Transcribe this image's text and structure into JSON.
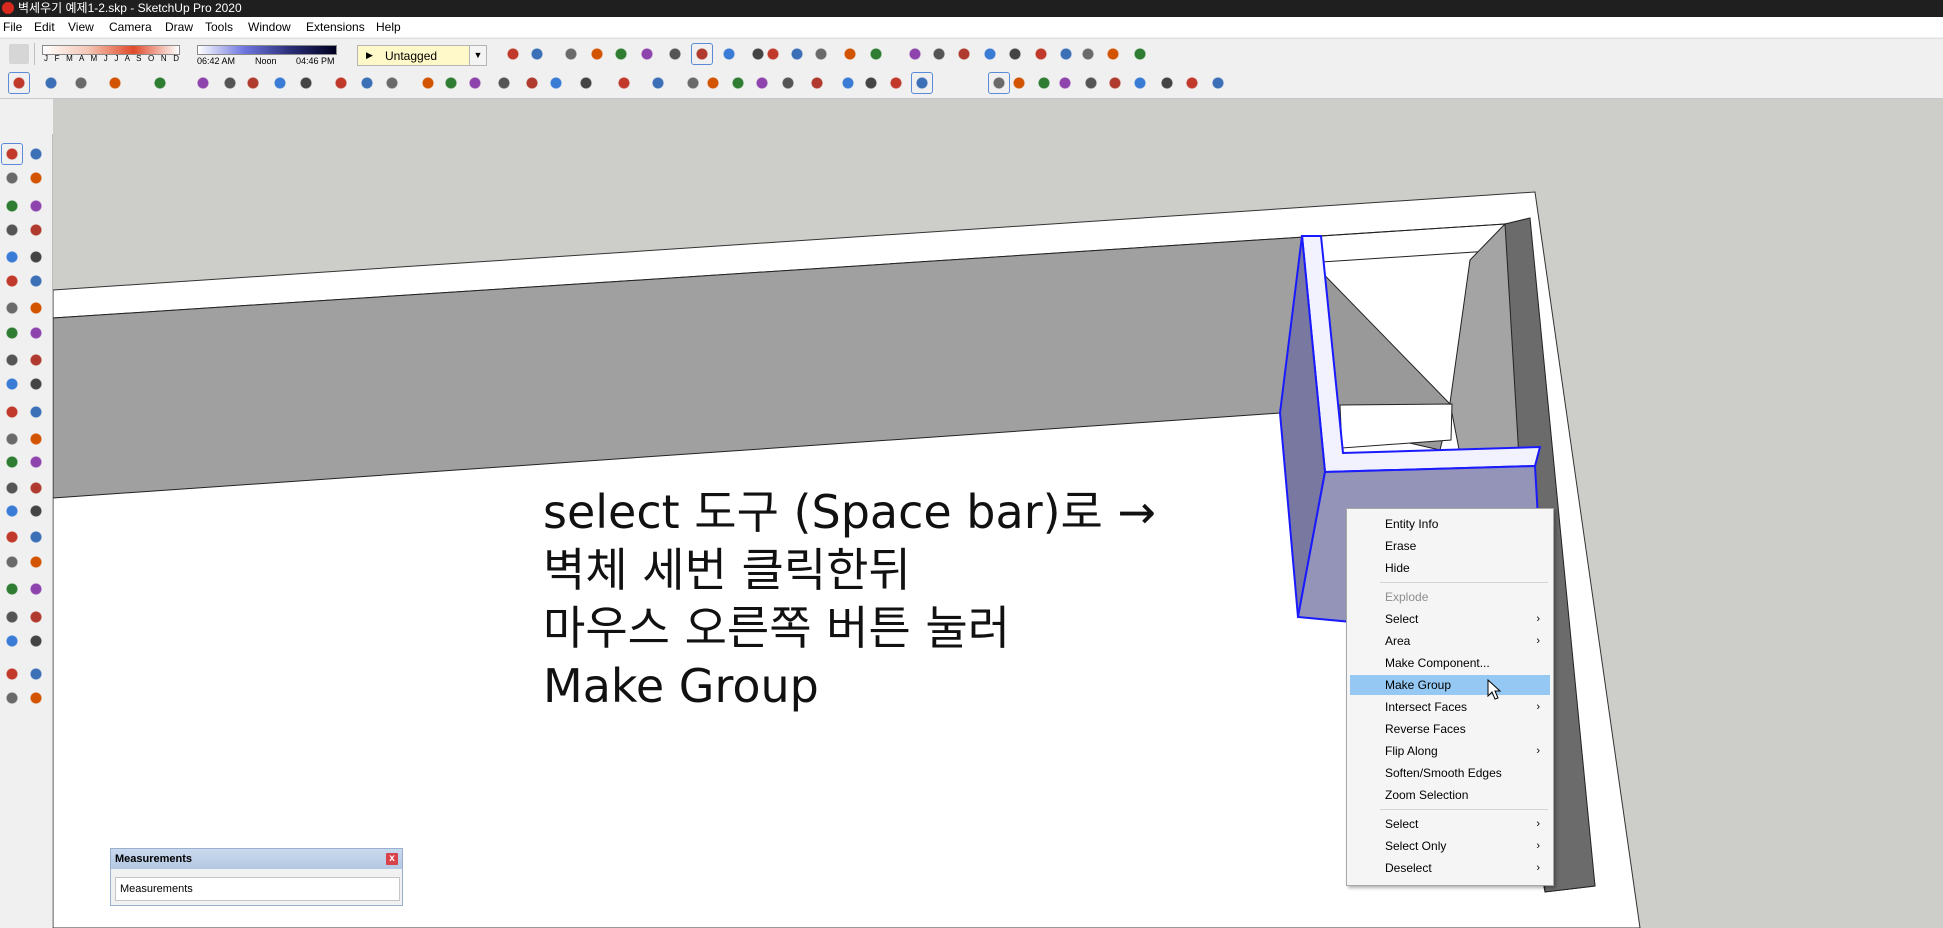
{
  "window": {
    "title": "벽세우기 예제1-2.skp - SketchUp Pro 2020"
  },
  "menu": [
    "File",
    "Edit",
    "View",
    "Camera",
    "Draw",
    "Tools",
    "Window",
    "Extensions",
    "Help"
  ],
  "shadow_settings": {
    "months": "J F M A M J J A S O N D",
    "time_start": "06:42 AM",
    "time_mid": "Noon",
    "time_end": "04:46 PM"
  },
  "tag_dropdown": {
    "value": "Untagged"
  },
  "annotation": {
    "line1": "select 도구 (Space bar)로 →",
    "line2": "벽체 세번 클릭한뒤",
    "line3": "마우스 오른쪽 버튼 눌러",
    "line4": "Make Group"
  },
  "context_menu": {
    "items": [
      {
        "label": "Entity Info"
      },
      {
        "label": "Erase"
      },
      {
        "label": "Hide"
      },
      {
        "label": "Explode",
        "disabled": true
      },
      {
        "label": "Select",
        "submenu": true
      },
      {
        "label": "Area",
        "submenu": true
      },
      {
        "label": "Make Component..."
      },
      {
        "label": "Make Group",
        "highlighted": true
      },
      {
        "label": "Intersect Faces",
        "submenu": true
      },
      {
        "label": "Reverse Faces"
      },
      {
        "label": "Flip Along",
        "submenu": true
      },
      {
        "label": "Soften/Smooth Edges"
      },
      {
        "label": "Zoom Selection"
      },
      {
        "label": "Select",
        "submenu": true
      },
      {
        "label": "Select Only",
        "submenu": true
      },
      {
        "label": "Deselect",
        "submenu": true
      }
    ],
    "submenu_glyph": "›"
  },
  "measurements": {
    "title": "Measurements",
    "field_label": "Measurements",
    "close_glyph": "x"
  },
  "colors": {
    "sky": "#cdcdc9",
    "ground": "#ffffff",
    "wall_top": "#a0a0a0",
    "wall_side": "#6b6b6b",
    "selection": "#1a1aff",
    "menu_highlight": "#95c8f2"
  },
  "icons": {
    "top_toolbar_1": [
      "eraser-icon",
      "box-front-icon",
      "box-top-icon",
      "iso-icon",
      "top-view-icon",
      "front-view-icon",
      "right-view-icon",
      "back-view-icon",
      "left-view-icon",
      "xray-icon",
      "back-edges-icon",
      "wireframe-icon",
      "hidden-line-icon",
      "shaded-icon",
      "shaded-texture-icon",
      "monochrome-icon",
      "section-plane-icon",
      "section-display-icon",
      "walk-icon",
      "look-around-icon",
      "position-camera-icon",
      "zoom-icon",
      "zoom-window-icon",
      "zoom-extents-icon",
      "previous-view-icon",
      "orbit-icon",
      "pan-icon",
      "footprints-icon"
    ],
    "top_toolbar_2": [
      "select-icon",
      "eraser-icon",
      "pencil-icon",
      "arc-icon",
      "rectangle-icon",
      "pushpull-icon",
      "followme-icon",
      "move-icon",
      "rotate-icon",
      "scale-icon",
      "tape-icon",
      "text-icon",
      "paint-bucket-icon",
      "orbit-icon",
      "pan-icon",
      "zoom-icon",
      "zoom-extents-icon",
      "warehouse-icon",
      "extension-icon",
      "share-icon",
      "ruby-icon",
      "profile-icon",
      "components-icon",
      "solid-union-icon",
      "solid-subtract-icon",
      "solid-trim-icon",
      "solid-split-icon",
      "solid-intersect-icon",
      "sandbox-icon",
      "smoove-icon",
      "stamp-icon",
      "drape-icon",
      "axes-icon",
      "section-icon",
      "section-fill-icon",
      "section-cut-icon",
      "iso-view-icon",
      "layout-icon",
      "house-icon",
      "house-outline-icon",
      "box-icon"
    ],
    "left_toolbar": [
      "select-icon",
      "component-icon",
      "paint-icon",
      "eraser-icon",
      "line-icon",
      "freehand-icon",
      "rectangle-icon",
      "rotated-rectangle-icon",
      "circle-icon",
      "polygon-icon",
      "arc-icon",
      "pie-icon",
      "two-point-arc-icon",
      "three-point-arc-icon",
      "move-icon",
      "pushpull-icon",
      "rotate-icon",
      "followme-icon",
      "scale-icon",
      "offset-icon",
      "tape-icon",
      "dimension-icon",
      "protractor-icon",
      "text-icon",
      "axes-icon",
      "3d-text-icon",
      "orbit-icon",
      "pan-icon",
      "zoom-icon",
      "zoom-window-icon",
      "zoom-extents-icon",
      "prev-view-icon",
      "position-camera-icon",
      "look-around-icon",
      "walk-icon",
      "section-plane-icon",
      "warehouse-icon",
      "extension-warehouse-icon",
      "send-layout-icon",
      "ruby-icon"
    ]
  }
}
